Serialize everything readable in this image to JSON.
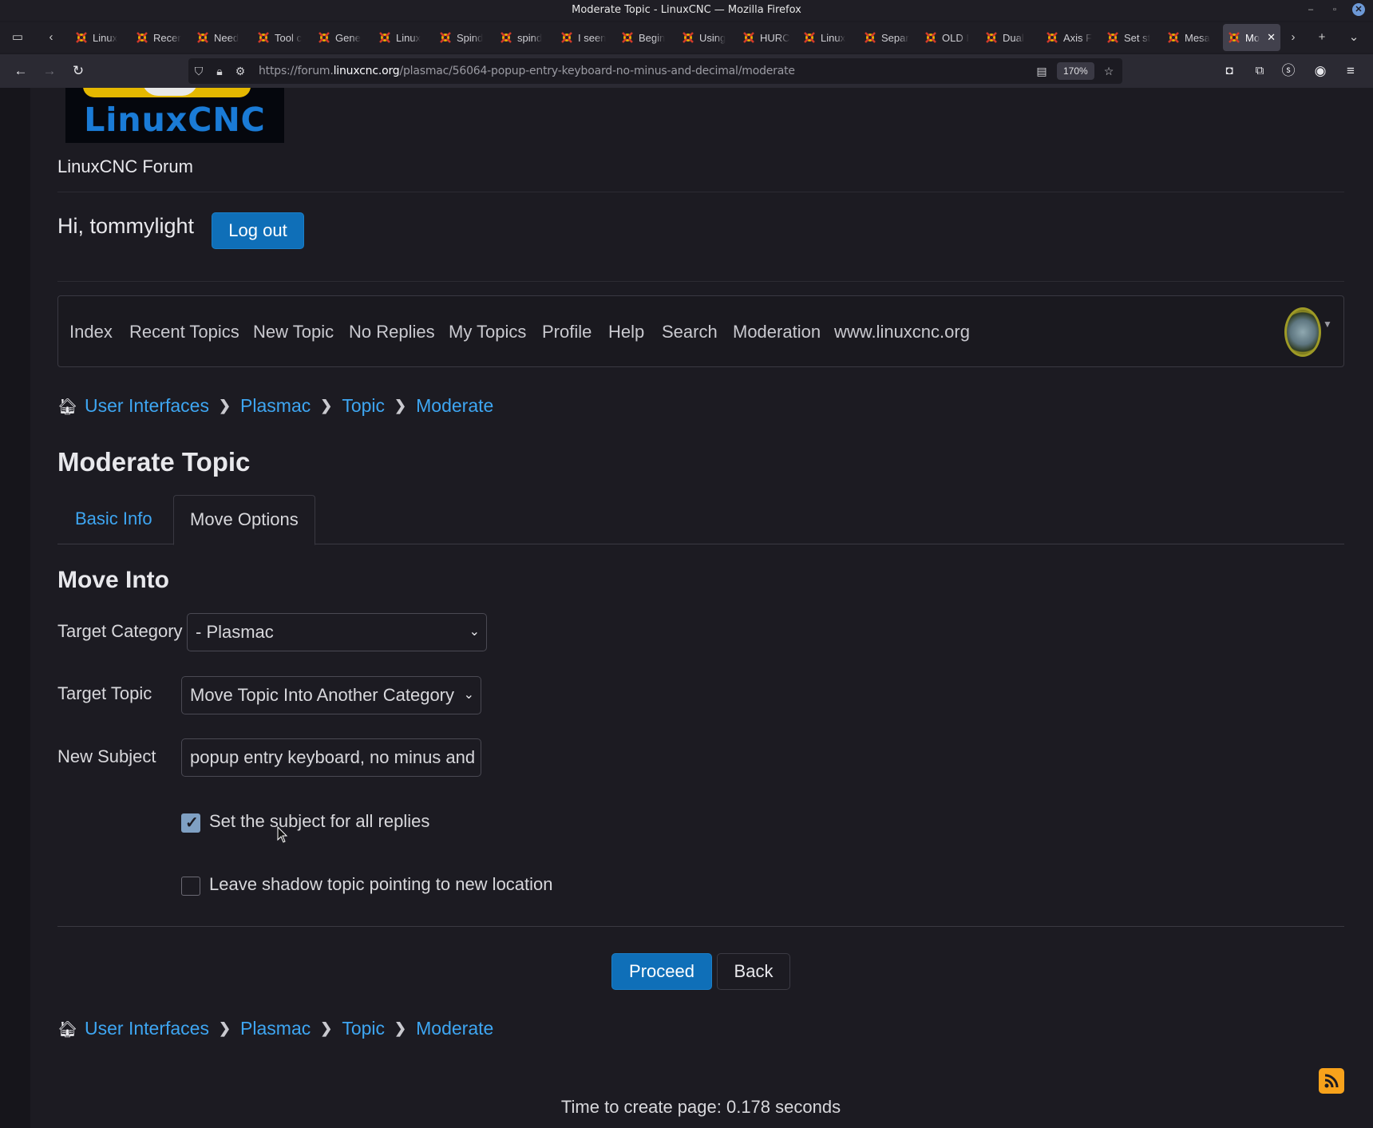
{
  "window": {
    "title": "Moderate Topic - LinuxCNC — Mozilla Firefox"
  },
  "tabs": [
    {
      "label": "Linux"
    },
    {
      "label": "Recer"
    },
    {
      "label": "Need"
    },
    {
      "label": "Tool c"
    },
    {
      "label": "Gene"
    },
    {
      "label": "Linux"
    },
    {
      "label": "Spind"
    },
    {
      "label": "spind"
    },
    {
      "label": "I seen"
    },
    {
      "label": "Begin"
    },
    {
      "label": "Using"
    },
    {
      "label": "HURC"
    },
    {
      "label": "Linux"
    },
    {
      "label": "Separ"
    },
    {
      "label": "OLD I"
    },
    {
      "label": "Dual"
    },
    {
      "label": "Axis F"
    },
    {
      "label": "Set st"
    },
    {
      "label": "Mesa"
    }
  ],
  "active_tab": {
    "label": "Mo"
  },
  "address_bar": {
    "prefix": "https://forum.",
    "domain": "linuxcnc.org",
    "path": "/plasmac/56064-popup-entry-keyboard-no-minus-and-decimal/moderate",
    "zoom": "170%"
  },
  "site": {
    "logo_text": "LinuxCNC",
    "name": "LinuxCNC Forum"
  },
  "user": {
    "greeting": "Hi, tommylight",
    "logout_label": "Log out"
  },
  "main_nav": [
    {
      "label": "Index"
    },
    {
      "label": "Recent Topics"
    },
    {
      "label": "New Topic"
    },
    {
      "label": "No Replies"
    },
    {
      "label": "My Topics"
    },
    {
      "label": "Profile"
    },
    {
      "label": "Help"
    },
    {
      "label": "Search"
    },
    {
      "label": "Moderation"
    },
    {
      "label": "www.linuxcnc.org"
    }
  ],
  "breadcrumb": [
    {
      "label": "User Interfaces"
    },
    {
      "label": "Plasmac"
    },
    {
      "label": "Topic"
    },
    {
      "label": "Moderate"
    }
  ],
  "page_title": "Moderate Topic",
  "content_tabs": [
    {
      "label": "Basic Info"
    },
    {
      "label": "Move Options"
    }
  ],
  "section_title": "Move Into",
  "form": {
    "target_category_label": "Target Category",
    "target_category_value": "- Plasmac",
    "target_topic_label": "Target Topic",
    "target_topic_value": "Move Topic Into Another Category",
    "new_subject_label": "New Subject",
    "new_subject_value": "popup entry keyboard, no minus and decimal",
    "set_subject_label": "Set the subject for all replies",
    "set_subject_checked": true,
    "shadow_label": "Leave shadow topic pointing to new location",
    "shadow_checked": false,
    "proceed_label": "Proceed",
    "back_label": "Back"
  },
  "footer": {
    "time_text": "Time to create page: 0.178 seconds"
  },
  "colors": {
    "link": "#3ea6f2",
    "primary_button": "#0f6fb8",
    "background": "#1c1b22",
    "rss": "#f7a21b"
  }
}
